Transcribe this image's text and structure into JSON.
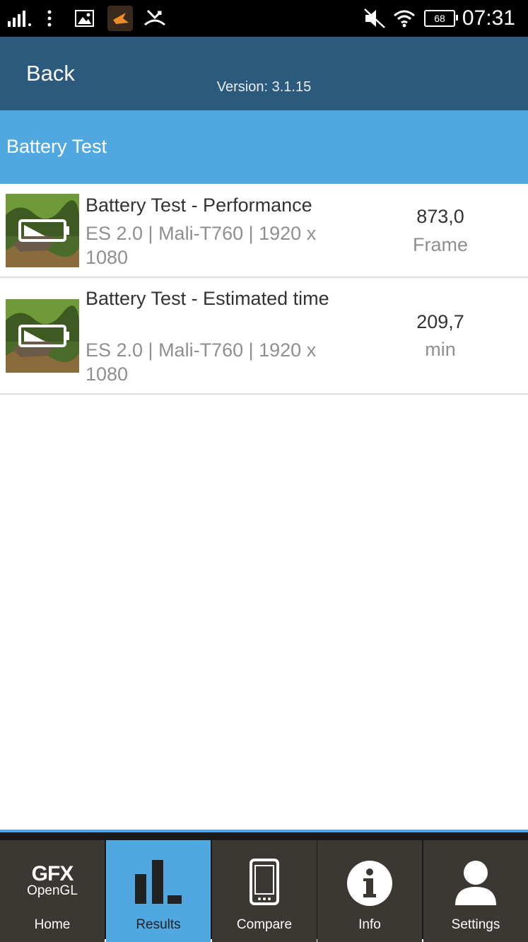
{
  "status_bar": {
    "time": "07:31",
    "battery_level": "68",
    "icons": [
      "signal-icon",
      "more-icon",
      "gallery-icon",
      "app-icon",
      "missed-call-icon",
      "mute-icon",
      "wifi-icon",
      "battery-icon"
    ]
  },
  "header": {
    "back_label": "Back",
    "version": "Version: 3.1.15"
  },
  "section": {
    "title": "Battery Test"
  },
  "results": [
    {
      "title": "Battery Test - Performance",
      "subtitle": "ES 2.0 | Mali-T760 | 1920 x 1080",
      "score": "873,0",
      "unit": "Frame"
    },
    {
      "title": "Battery Test - Estimated time",
      "subtitle": "ES 2.0 | Mali-T760 | 1920 x 1080",
      "score": "209,7",
      "unit": "min"
    }
  ],
  "nav": {
    "logo_main": "GFX",
    "logo_sub": "OpenGL",
    "tabs": [
      {
        "label": "Home",
        "icon": "gfx-logo"
      },
      {
        "label": "Results",
        "icon": "bar-chart-icon",
        "active": true
      },
      {
        "label": "Compare",
        "icon": "phone-icon"
      },
      {
        "label": "Info",
        "icon": "info-icon"
      },
      {
        "label": "Settings",
        "icon": "user-icon"
      }
    ]
  },
  "colors": {
    "header_bg": "#2b5a7c",
    "section_bg": "#51a8e0",
    "nav_bg": "#3b3732",
    "nav_active": "#51a8e0"
  }
}
